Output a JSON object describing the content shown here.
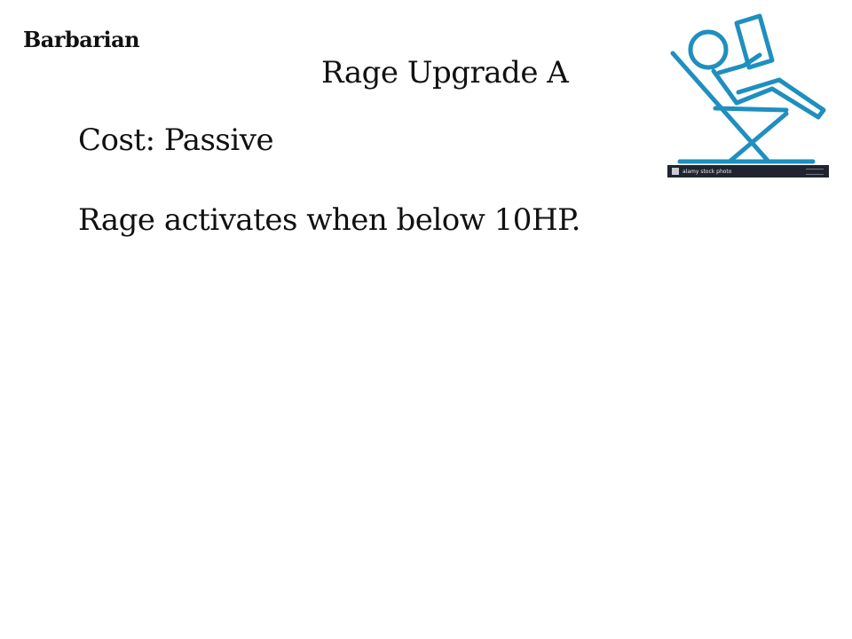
{
  "slide": {
    "class_name": "Barbarian",
    "title": "Rage Upgrade A",
    "cost": "Cost: Passive",
    "description": "Rage activates when below 10HP."
  },
  "illustration": {
    "icon": "stick-figure-falling-chair-icon",
    "stroke_color": "#1f8fbf",
    "watermark": "alamy stock photo"
  }
}
